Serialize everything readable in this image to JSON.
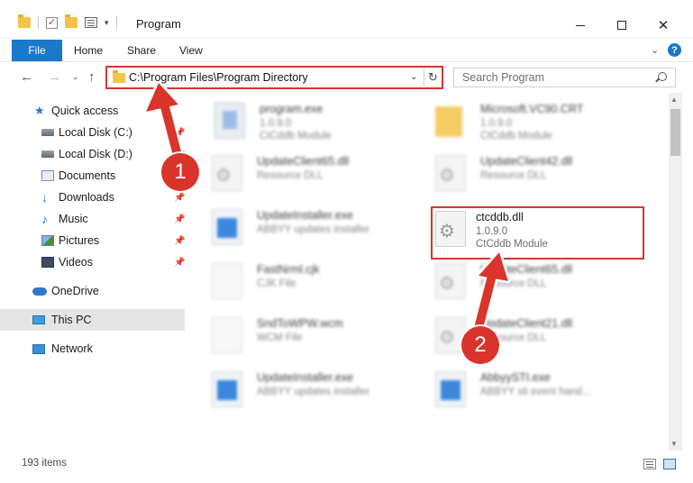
{
  "window": {
    "title": "Program",
    "minimize_glyph": "—",
    "close_glyph": "✕"
  },
  "quick_access_toolbar": {
    "check_glyph": "✓",
    "dropdown_glyph": "▾"
  },
  "ribbon": {
    "tabs": [
      "File",
      "Home",
      "Share",
      "View"
    ],
    "active_tab": "File",
    "collapse_glyph": "⌄",
    "help_glyph": "?"
  },
  "navigation": {
    "back_glyph": "←",
    "forward_glyph": "→",
    "recent_glyph": "⌄",
    "up_glyph": "↑",
    "address": "C:\\Program Files\\Program Directory",
    "address_dropdown_glyph": "⌄",
    "refresh_glyph": "↻",
    "search_placeholder": "Search Program"
  },
  "sidebar": {
    "pin_glyph": "📌",
    "items": [
      {
        "label": "Quick access",
        "icon": "star-icon",
        "glyph": "★",
        "pinned": false
      },
      {
        "label": "Local Disk (C:)",
        "icon": "disk-icon",
        "pinned": true
      },
      {
        "label": "Local Disk (D:)",
        "icon": "disk-icon",
        "pinned": true
      },
      {
        "label": "Documents",
        "icon": "documents-icon",
        "pinned": true
      },
      {
        "label": "Downloads",
        "icon": "download-icon",
        "glyph": "↓",
        "pinned": true
      },
      {
        "label": "Music",
        "icon": "music-icon",
        "glyph": "♪",
        "pinned": true
      },
      {
        "label": "Pictures",
        "icon": "pictures-icon",
        "pinned": true
      },
      {
        "label": "Videos",
        "icon": "videos-icon",
        "pinned": true
      },
      {
        "label": "OneDrive",
        "icon": "cloud-icon",
        "pinned": false
      },
      {
        "label": "This PC",
        "icon": "pc-icon",
        "pinned": false,
        "selected": true
      },
      {
        "label": "Network",
        "icon": "network-icon",
        "pinned": false
      }
    ]
  },
  "files": [
    {
      "name": "program.exe",
      "line2": "1.0.9.0",
      "line3": "CtCddb Module",
      "icon": "program-icon",
      "blurred": true
    },
    {
      "name": "Microsoft.VC90.CRT",
      "line2": "1.0.9.0",
      "line3": "CtCddb Module",
      "icon": "folder-icon",
      "blurred": true
    },
    {
      "name": "UpdateClient65.dll",
      "line2": "Resource DLL",
      "line3": "",
      "icon": "dll-icon",
      "blurred": true
    },
    {
      "name": "UpdateClient42.dll",
      "line2": "Resource DLL",
      "line3": "",
      "icon": "dll-icon",
      "blurred": true
    },
    {
      "name": "UpdateInstaller.exe",
      "line2": "ABBYY updates installer",
      "line3": "",
      "icon": "exe-icon",
      "blurred": true
    },
    {
      "name": "ctcddb.dll",
      "line2": "1.0.9.0",
      "line3": "CtCddb Module",
      "icon": "dll-icon",
      "blurred": false
    },
    {
      "name": "FastNrml.cjk",
      "line2": "CJK File",
      "line3": "",
      "icon": "file-icon",
      "blurred": true
    },
    {
      "name": "UpdateClient65.dll",
      "line2": "Resource DLL",
      "line3": "",
      "icon": "dll-icon",
      "blurred": true
    },
    {
      "name": "SndToWPW.wcm",
      "line2": "WCM File",
      "line3": "",
      "icon": "file-icon",
      "blurred": true
    },
    {
      "name": "UpdateClient21.dll",
      "line2": "Resource DLL",
      "line3": "",
      "icon": "dll-icon",
      "blurred": true
    },
    {
      "name": "UpdateInstaller.exe",
      "line2": "ABBYY updates installer",
      "line3": "",
      "icon": "exe-icon",
      "blurred": true
    },
    {
      "name": "AbbyySTI.exe",
      "line2": "ABBYY sti event hand...",
      "line3": "",
      "icon": "exe-icon",
      "blurred": true
    }
  ],
  "scrollbar": {
    "up_glyph": "▲",
    "down_glyph": "▼"
  },
  "status": {
    "items_count": "193 items"
  },
  "annotations": {
    "step1": "1",
    "step2": "2",
    "color": "#d9342b"
  }
}
